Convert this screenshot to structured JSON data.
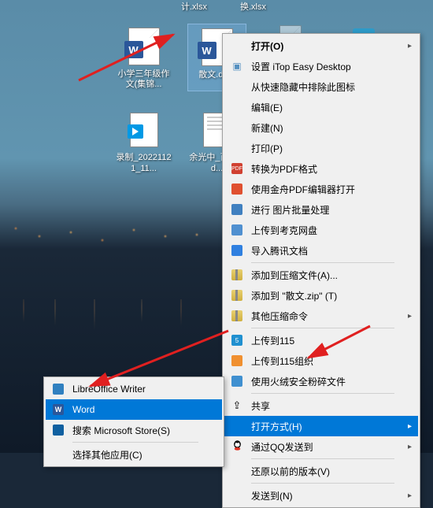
{
  "desktop": {
    "partial_labels": {
      "xlsx1": "计.xlsx",
      "xlsx2": "换.xlsx"
    },
    "icons": {
      "word1": "小学三年级作文(集锦...",
      "word2": "散文.do...",
      "video": "录制_20221121_11...",
      "odt": "余光中_百科.od..."
    }
  },
  "menu": {
    "open": "打开(O)",
    "itop": "设置 iTop Easy Desktop",
    "hide_quick": "从快速隐藏中排除此图标",
    "edit": "编辑(E)",
    "new": "新建(N)",
    "print": "打印(P)",
    "pdf_convert": "转换为PDF格式",
    "pdf_jinzhou": "使用金舟PDF编辑器打开",
    "batch_img": "进行 图片批量处理",
    "upload_kk": "上传到考克网盘",
    "import_tx": "导入腾讯文档",
    "add_zip_a": "添加到压缩文件(A)...",
    "add_zip_t": "添加到 \"散文.zip\" (T)",
    "other_zip": "其他压缩命令",
    "up_115": "上传到115",
    "up_115_org": "上传到115组织",
    "huorong": "使用火绒安全粉碎文件",
    "share": "共享",
    "open_with": "打开方式(H)",
    "qq_send": "通过QQ发送到",
    "restore": "还原以前的版本(V)",
    "send_to": "发送到(N)"
  },
  "submenu": {
    "libreoffice": "LibreOffice Writer",
    "word": "Word",
    "store": "搜索 Microsoft Store(S)",
    "other": "选择其他应用(C)"
  }
}
